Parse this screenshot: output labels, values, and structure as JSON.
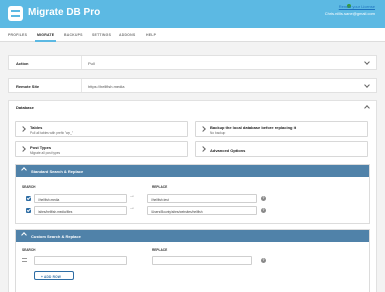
{
  "header": {
    "title": "Migrate DB Pro",
    "license_link": "Renew your License",
    "user_email": "Chris.nillis.sane@gmail.com"
  },
  "tabs": [
    "PROFILES",
    "MIGRATE",
    "BACKUPS",
    "SETTINGS",
    "ADDONS",
    "HELP"
  ],
  "active_tab": "MIGRATE",
  "action": {
    "label": "Action",
    "value": "Pull"
  },
  "remote_site": {
    "label": "Remote Site",
    "value": "https://hellfish.media"
  },
  "database": {
    "label": "Database",
    "tables": {
      "title": "Tables",
      "subtitle": "Pull all tables with prefix \"wp_\""
    },
    "backup": {
      "title": "Backup the local database before replacing it",
      "subtitle": "No backup"
    },
    "post_types": {
      "title": "Post Types",
      "subtitle": "Migrate all post types"
    },
    "advanced": {
      "title": "Advanced Options"
    }
  },
  "standard_sr": {
    "title": "Standard Search & Replace",
    "search_head": "SEARCH",
    "replace_head": "REPLACE",
    "rows": [
      {
        "search": "//hellfish.media",
        "replace": "//hellfish.test"
      },
      {
        "search": "/sites/hellfish.media/files",
        "replace": "/Users/Bounty/sites/websites/hellfish"
      }
    ]
  },
  "custom_sr": {
    "title": "Custom Search & Replace",
    "search_head": "SEARCH",
    "replace_head": "REPLACE",
    "search_value": "",
    "replace_value": "",
    "add_row": "+ ADD ROW"
  },
  "colors": {
    "header": "#5cb9e3",
    "section_header": "#5082a9",
    "accent": "#2e6da4"
  }
}
